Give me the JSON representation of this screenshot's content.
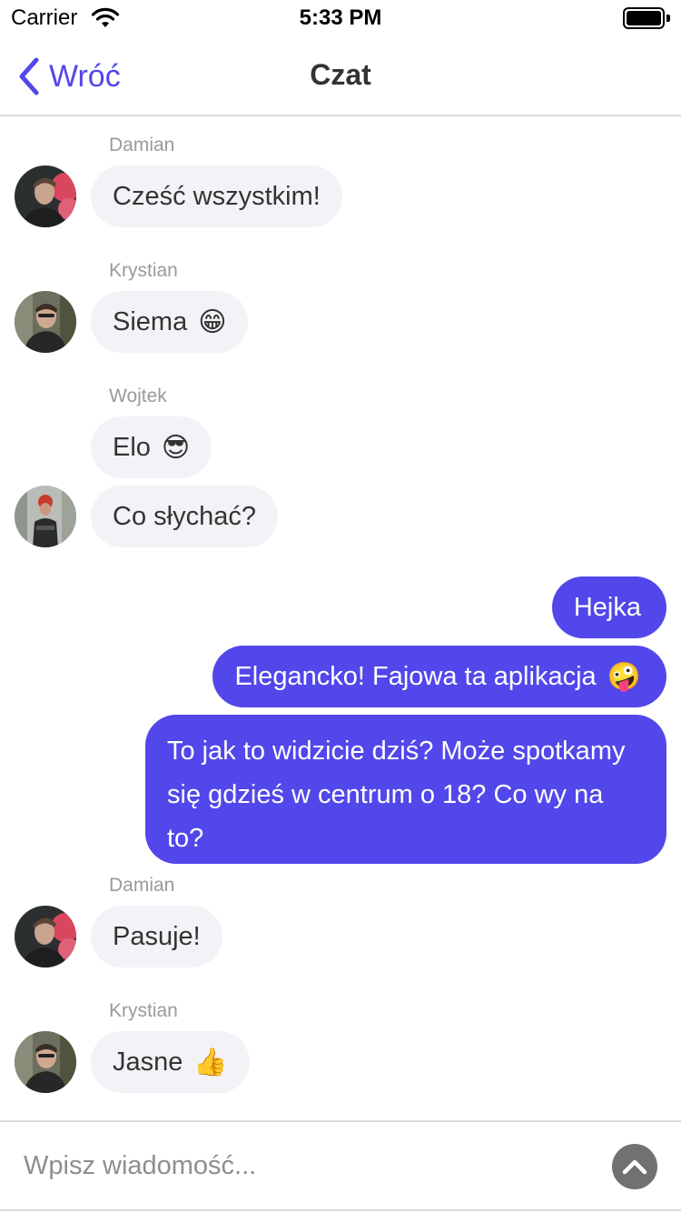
{
  "status_bar": {
    "carrier": "Carrier",
    "time": "5:33 PM"
  },
  "nav": {
    "back_label": "Wróć",
    "title": "Czat"
  },
  "colors": {
    "accent": "#5247ea",
    "incoming_bubble": "#f3f3f7",
    "sender_name": "#9a9a9a"
  },
  "messages": [
    {
      "sender": "Damian",
      "text": "Cześć wszystkim!",
      "emoji": "",
      "direction": "incoming"
    },
    {
      "sender": "Krystian",
      "text": "Siema",
      "emoji": "😁",
      "direction": "incoming"
    },
    {
      "sender": "Wojtek",
      "text": "Elo",
      "emoji": "😎",
      "direction": "incoming"
    },
    {
      "sender": "Wojtek",
      "text": "Co słychać?",
      "emoji": "",
      "direction": "incoming"
    },
    {
      "sender": "",
      "text": "Hejka",
      "emoji": "",
      "direction": "outgoing"
    },
    {
      "sender": "",
      "text": "Elegancko! Fajowa ta aplikacja",
      "emoji": "🤪",
      "direction": "outgoing"
    },
    {
      "sender": "",
      "text": "To jak to widzicie dziś? Może spotkamy się gdzieś w centrum o 18? Co wy na to?",
      "emoji": "",
      "direction": "outgoing"
    },
    {
      "sender": "Damian",
      "text": "Pasuje!",
      "emoji": "",
      "direction": "incoming"
    },
    {
      "sender": "Krystian",
      "text": "Jasne",
      "emoji": "👍",
      "direction": "incoming"
    }
  ],
  "composer": {
    "placeholder": "Wpisz wiadomość...",
    "value": "",
    "send_icon": "chevron-up-icon"
  }
}
